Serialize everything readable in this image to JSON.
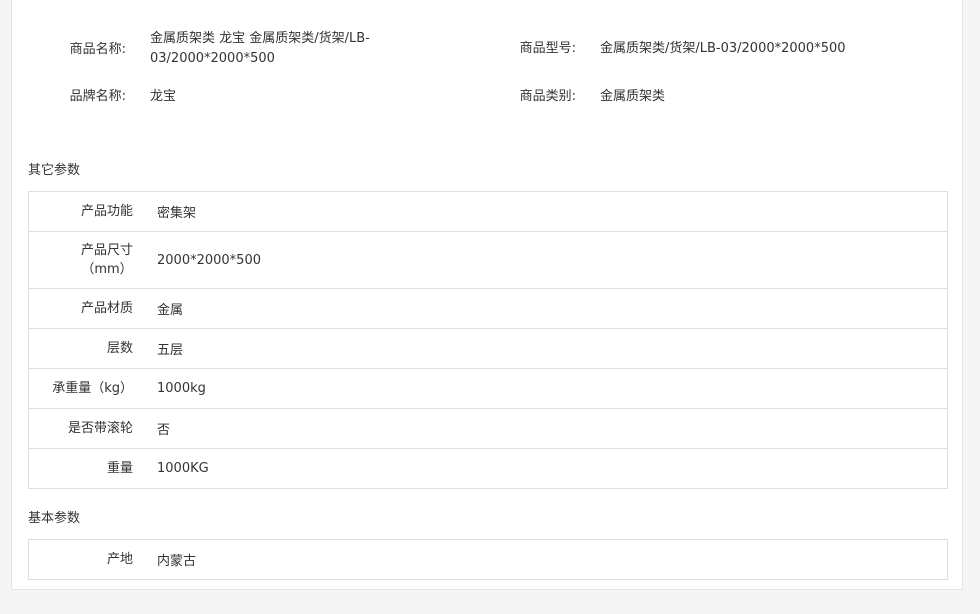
{
  "product_info": {
    "name_label": "商品名称:",
    "name_value_line1": "金属质架类 龙宝 金属质架类/货架/LB-",
    "name_value_line2": "03/2000*2000*500",
    "model_label": "商品型号:",
    "model_value": "金属质架类/货架/LB-03/2000*2000*500",
    "brand_label": "品牌名称:",
    "brand_value": "龙宝",
    "category_label": "商品类别:",
    "category_value": "金属质架类"
  },
  "other_params": {
    "title": "其它参数",
    "rows": [
      {
        "key": "产品功能",
        "value": "密集架"
      },
      {
        "key_line1": "产品尺寸",
        "key_line2": "（mm）",
        "value": "2000*2000*500"
      },
      {
        "key": "产品材质",
        "value": "金属"
      },
      {
        "key": "层数",
        "value": "五层"
      },
      {
        "key": "承重量（kg）",
        "value": "1000kg"
      },
      {
        "key": "是否带滚轮",
        "value": "否"
      },
      {
        "key": "重量",
        "value": "1000KG"
      }
    ]
  },
  "basic_params": {
    "title": "基本参数",
    "rows": [
      {
        "key": "产地",
        "value": "内蒙古"
      }
    ]
  }
}
